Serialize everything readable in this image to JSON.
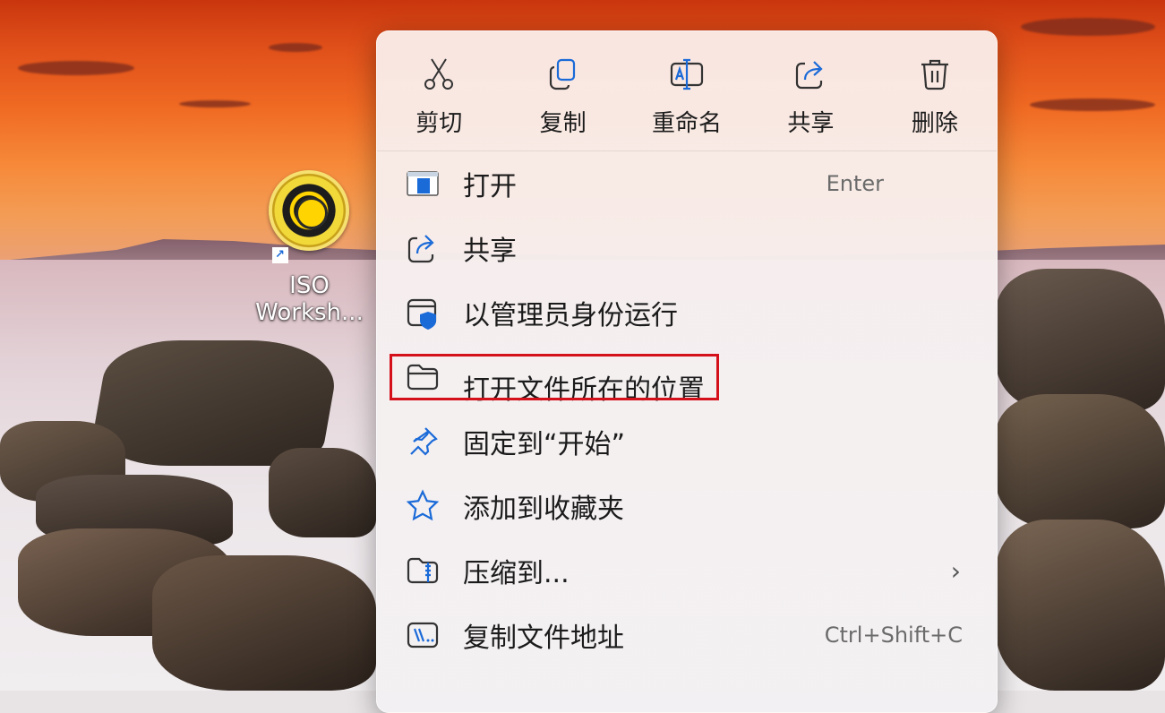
{
  "desktop": {
    "icon_label": "ISO\nWorksh..."
  },
  "menu": {
    "quick_actions": [
      {
        "label": "剪切",
        "icon": "cut-icon"
      },
      {
        "label": "复制",
        "icon": "copy-icon"
      },
      {
        "label": "重命名",
        "icon": "rename-icon"
      },
      {
        "label": "共享",
        "icon": "share-icon"
      },
      {
        "label": "删除",
        "icon": "delete-icon"
      }
    ],
    "items": [
      {
        "label": "打开",
        "shortcut": "Enter",
        "icon": "open-app-icon"
      },
      {
        "label": "共享",
        "shortcut": "",
        "icon": "share-icon"
      },
      {
        "label": "以管理员身份运行",
        "shortcut": "",
        "icon": "run-as-admin-shield-icon"
      },
      {
        "label": "打开文件所在的位置",
        "shortcut": "",
        "icon": "folder-icon"
      },
      {
        "label": "固定到“开始”",
        "shortcut": "",
        "icon": "pin-icon"
      },
      {
        "label": "添加到收藏夹",
        "shortcut": "",
        "icon": "star-icon"
      },
      {
        "label": "压缩到...",
        "shortcut": "",
        "icon": "zip-folder-icon",
        "has_submenu": true
      },
      {
        "label": "复制文件地址",
        "shortcut": "Ctrl+Shift+C",
        "icon": "copy-path-icon"
      }
    ],
    "highlighted_item": "打开文件所在的位置",
    "highlight_color": "#d4101a",
    "accent_color": "#1a6ad8"
  }
}
